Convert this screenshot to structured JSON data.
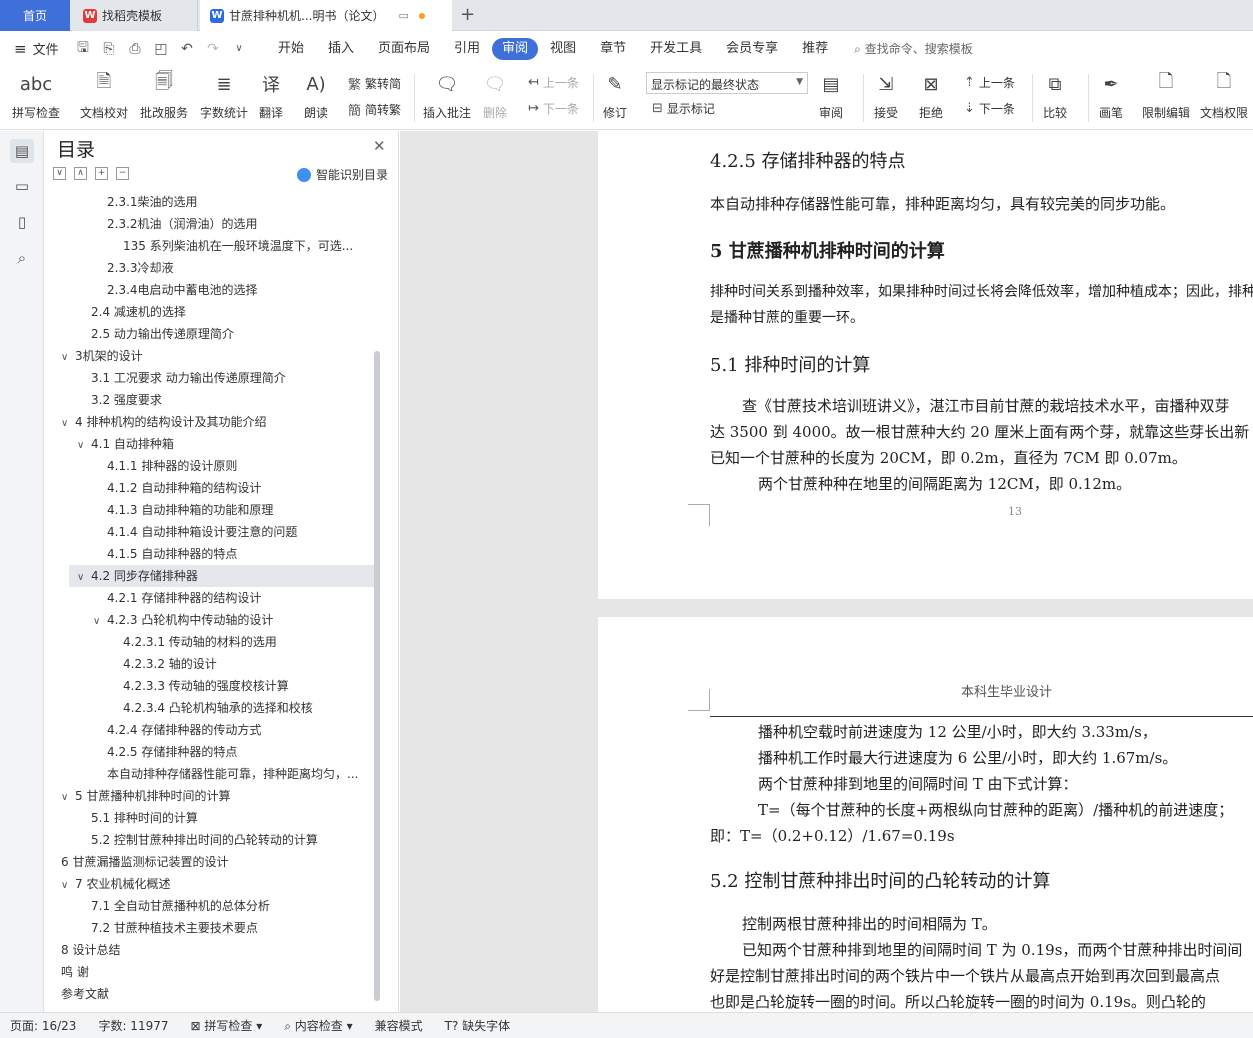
{
  "tabs": {
    "home": "首页",
    "template": "找稻壳模板",
    "doc": "甘蔗排种机机...明书（论文）"
  },
  "menu": {
    "file": "文件",
    "tabs": [
      "开始",
      "插入",
      "页面布局",
      "引用",
      "审阅",
      "视图",
      "章节",
      "开发工具",
      "会员专享",
      "推荐"
    ],
    "search": "查找命令、搜索模板"
  },
  "ribbon": {
    "spell": "拼写检查",
    "proof": "文档校对",
    "batch": "批改服务",
    "count": "字数统计",
    "translate": "翻译",
    "read": "朗读",
    "to_trad": "繁转简",
    "to_simp": "简转繁",
    "insert_comment": "插入批注",
    "delete": "删除",
    "prev": "上一条",
    "next": "下一条",
    "revise": "修订",
    "markup_state": "显示标记的最终状态",
    "show_markup": "显示标记",
    "review": "审阅",
    "accept": "接受",
    "reject": "拒绝",
    "prev2": "上一条",
    "next2": "下一条",
    "compare": "比较",
    "pen": "画笔",
    "restrict": "限制编辑",
    "rights": "文档权限"
  },
  "toc": {
    "title": "目录",
    "smart": "智能识别目录",
    "items": [
      {
        "text": "2.3.1柴油的选用",
        "level": 3
      },
      {
        "text": "2.3.2机油（润滑油）的选用",
        "level": 3
      },
      {
        "text": "135 系列柴油机在一般环境温度下，可选...",
        "level": 4
      },
      {
        "text": "2.3.3冷却液",
        "level": 3
      },
      {
        "text": "2.3.4电启动中蓄电池的选择",
        "level": 3
      },
      {
        "text": "2.4  减速机的选择",
        "level": 2
      },
      {
        "text": "2.5  动力输出传递原理简介",
        "level": 2
      },
      {
        "text": "3机架的设计",
        "level": 1,
        "caret": "∨"
      },
      {
        "text": "3.1  工况要求  动力输出传递原理简介",
        "level": 2
      },
      {
        "text": "3.2    强度要求",
        "level": 2
      },
      {
        "text": "4     排种机构的结构设计及其功能介绍",
        "level": 1,
        "caret": "∨"
      },
      {
        "text": "4.1  自动排种箱",
        "level": 2,
        "caret": "∨"
      },
      {
        "text": "4.1.1  排种器的设计原则",
        "level": 3
      },
      {
        "text": "4.1.2  自动排种箱的结构设计",
        "level": 3
      },
      {
        "text": "4.1.3  自动排种箱的功能和原理",
        "level": 3
      },
      {
        "text": "4.1.4  自动排种箱设计要注意的问题",
        "level": 3
      },
      {
        "text": "4.1.5  自动排种器的特点",
        "level": 3
      },
      {
        "text": "4.2 同步存储排种器",
        "level": 2,
        "caret": "∨",
        "selected": true
      },
      {
        "text": "4.2.1  存储排种器的结构设计",
        "level": 3
      },
      {
        "text": "4.2.3  凸轮机构中传动轴的设计",
        "level": 3,
        "caret": "∨"
      },
      {
        "text": "4.2.3.1 传动轴的材料的选用",
        "level": 4
      },
      {
        "text": "4.2.3.2 轴的设计",
        "level": 4
      },
      {
        "text": "4.2.3.3  传动轴的强度校核计算",
        "level": 4
      },
      {
        "text": "4.2.3.4 凸轮机构轴承的选择和校核",
        "level": 4
      },
      {
        "text": "4.2.4  存储排种器的传动方式",
        "level": 3
      },
      {
        "text": "4.2.5 存储排种器的特点",
        "level": 3
      },
      {
        "text": "本自动排种存储器性能可靠，排种距离均匀，...",
        "level": 3
      },
      {
        "text": "5     甘蔗播种机排种时间的计算",
        "level": 1,
        "caret": "∨"
      },
      {
        "text": "5.1  排种时间的计算",
        "level": 2
      },
      {
        "text": "5.2 控制甘蔗种排出时间的凸轮转动的计算",
        "level": 2
      },
      {
        "text": "6     甘蔗漏播监测标记装置的设计",
        "level": 1
      },
      {
        "text": "7     农业机械化概述",
        "level": 1,
        "caret": "∨"
      },
      {
        "text": "7.1  全自动甘蔗播种机的总体分析",
        "level": 2
      },
      {
        "text": "7.2  甘蔗种植技术主要技术要点",
        "level": 2
      },
      {
        "text": "8    设计总结",
        "level": 1
      },
      {
        "text": "鸣    谢",
        "level": 1
      },
      {
        "text": "参考文献",
        "level": 1
      }
    ]
  },
  "doc": {
    "p1": {
      "h425": "4.2.5 存储排种器的特点",
      "l1": "本自动排种存储器性能可靠，排种距离均匀，具有较完美的同步功能。",
      "h5": "5    甘蔗播种机排种时间的计算",
      "l2": "排种时间关系到播种效率，如果排种时间过长将会降低效率，增加种植成本；因此，排种",
      "l3": "是播种甘蔗的重要一环。",
      "h51": "5.1  排种时间的计算",
      "l4": "查《甘蔗技术培训班讲义》，湛江市目前甘蔗的栽培技术水平，亩播种双芽",
      "l5": "达 3500 到 4000。故一根甘蔗种大约 20 厘米上面有两个芽，就靠这些芽长出新",
      "l6": "已知一个甘蔗种的长度为 20CM，即 0.2m，直径为 7CM 即 0.07m。",
      "l7": "两个甘蔗种种在地里的间隔距离为 12CM，即 0.12m。",
      "pnum": "13"
    },
    "p2": {
      "header": "本科生毕业设计",
      "l1": "播种机空载时前进速度为 12 公里/小时，即大约 3.33m/s，",
      "l2": "播种机工作时最大行进速度为 6 公里/小时，即大约 1.67m/s。",
      "l3": "两个甘蔗种排到地里的间隔时间 T 由下式计算：",
      "l4": "T=（每个甘蔗种的长度+两根纵向甘蔗种的距离）/播种机的前进速度；",
      "l5": "即：T=（0.2+0.12）/1.67=0.19s",
      "h52": "5.2 控制甘蔗种排出时间的凸轮转动的计算",
      "l6": "控制两根甘蔗种排出的时间相隔为 T。",
      "l7": "已知两个甘蔗种排到地里的间隔时间 T 为 0.19s，而两个甘蔗种排出时间间",
      "l8": "好是控制甘蔗排出时间的两个铁片中一个铁片从最高点开始到再次回到最高点",
      "l9": "也即是凸轮旋转一圈的时间。所以凸轮旋转一圈的时间为 0.19s。则凸轮的"
    }
  },
  "status": {
    "page": "页面: 16/23",
    "words": "字数: 11977",
    "spell": "拼写检查",
    "content": "内容检查",
    "compat": "兼容模式",
    "font": "缺失字体"
  }
}
